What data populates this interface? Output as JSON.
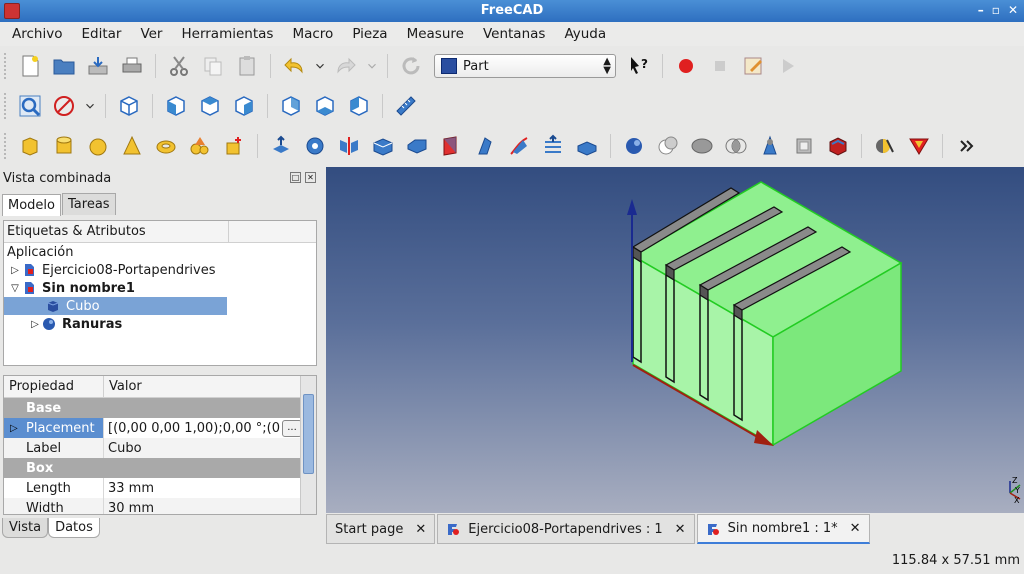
{
  "window": {
    "title": "FreeCAD"
  },
  "menu": [
    "Archivo",
    "Editar",
    "Ver",
    "Herramientas",
    "Macro",
    "Pieza",
    "Measure",
    "Ventanas",
    "Ayuda"
  ],
  "workbench": {
    "selected": "Part"
  },
  "combo_view": {
    "title": "Vista combinada",
    "tabs": [
      "Modelo",
      "Tareas"
    ],
    "active_tab": "Modelo",
    "tree_header": "Etiquetas & Atributos",
    "tree": {
      "root": "Aplicación",
      "items": [
        {
          "label": "Ejercicio08-Portapendrives",
          "expanded": false,
          "bold": false,
          "level": 0
        },
        {
          "label": "Sin nombre1",
          "expanded": true,
          "bold": true,
          "level": 0
        },
        {
          "label": "Cubo",
          "selected": true,
          "level": 1
        },
        {
          "label": "Ranuras",
          "bold": true,
          "level": 1
        }
      ]
    },
    "properties": {
      "headers": [
        "Propiedad",
        "Valor"
      ],
      "rows": [
        {
          "type": "group",
          "name": "Base"
        },
        {
          "type": "prop",
          "name": "Placement",
          "value": "[(0,00 0,00 1,00);0,00 °;(0",
          "selected": true
        },
        {
          "type": "prop",
          "name": "Label",
          "value": "Cubo"
        },
        {
          "type": "group",
          "name": "Box"
        },
        {
          "type": "prop",
          "name": "Length",
          "value": "33 mm"
        },
        {
          "type": "prop",
          "name": "Width",
          "value": "30 mm"
        }
      ],
      "more_button": "..."
    },
    "bottom_tabs": [
      "Vista",
      "Datos"
    ],
    "active_bottom_tab": "Datos"
  },
  "doc_tabs": [
    {
      "label": "Start page",
      "active": false
    },
    {
      "label": "Ejercicio08-Portapendrives : 1",
      "active": false
    },
    {
      "label": "Sin nombre1 : 1*",
      "active": true
    }
  ],
  "axis_labels": {
    "x": "X",
    "y": "Y",
    "z": "Z"
  },
  "status": {
    "coordinates": "115.84 x 57.51 mm"
  },
  "colors": {
    "selection": "#7aa3d6",
    "solid": "#8ff08f",
    "edge": "#22cc22"
  }
}
